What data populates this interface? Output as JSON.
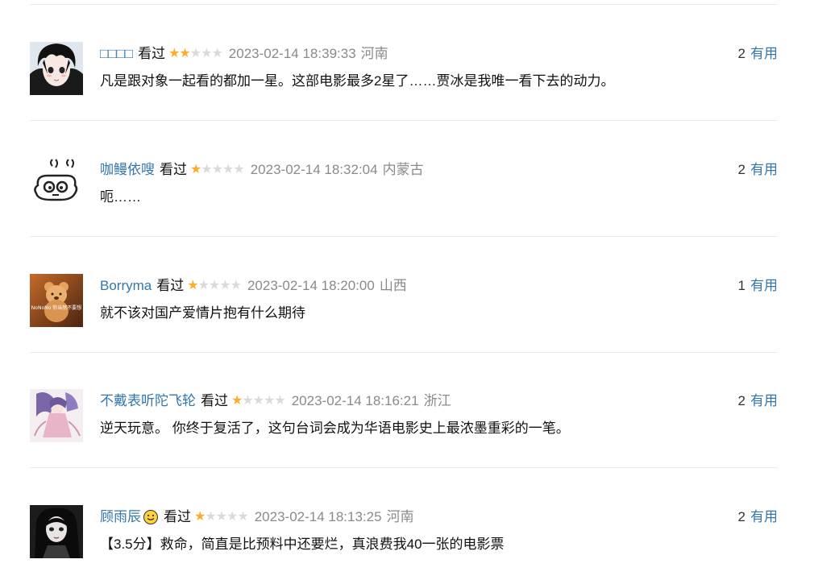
{
  "colors": {
    "link": "#3377aa",
    "star_on": "#ffac2d",
    "star_off": "#dadada",
    "muted": "#8a8a8a",
    "separator": "#ebebeb"
  },
  "comments": [
    {
      "author": "□□□□",
      "status": "看过",
      "rating": 2,
      "time": "2023-02-14 18:39:33",
      "location": "河南",
      "votes": "2",
      "vote_label": "有用",
      "text": "凡是跟对象一起看的都加一星。这部电影最多2星了……贾冰是我唯一看下去的动力。"
    },
    {
      "author": "咖鳗依嗖",
      "status": "看过",
      "rating": 1,
      "time": "2023-02-14 18:32:04",
      "location": "内蒙古",
      "votes": "2",
      "vote_label": "有用",
      "text": "呃……"
    },
    {
      "author": "Borryma",
      "status": "看过",
      "rating": 1,
      "time": "2023-02-14 18:20:00",
      "location": "山西",
      "votes": "1",
      "vote_label": "有用",
      "text": "就不该对国产爱情片抱有什么期待"
    },
    {
      "author": "不戴表听陀飞轮",
      "status": "看过",
      "rating": 1,
      "time": "2023-02-14 18:16:21",
      "location": "浙江",
      "votes": "2",
      "vote_label": "有用",
      "text": "逆天玩意。 你终于复活了，这句台词会成为华语电影史上最浓墨重彩的一笔。"
    },
    {
      "author": "顾雨辰",
      "status": "看过",
      "rating": 1,
      "time": "2023-02-14 18:13:25",
      "location": "河南",
      "votes": "2",
      "vote_label": "有用",
      "text": "【3.5分】救命，简直是比预料中还要烂，真浪费我40一张的电影票"
    }
  ],
  "avatar_watermark": "NoNoNo 你当然不要想"
}
